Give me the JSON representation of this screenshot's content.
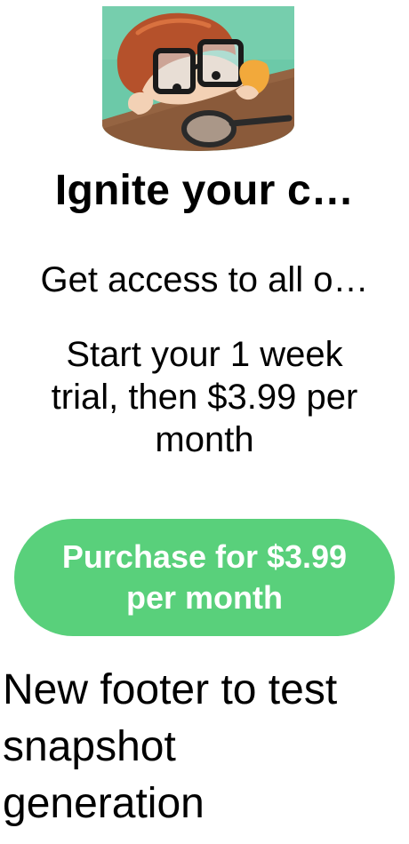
{
  "hero": {
    "icon": "child-with-glasses-and-magnifying-glass-illustration"
  },
  "title": "Ignite your c…",
  "subtitle": "Get access to all o…",
  "trial": {
    "lines": [
      "Start your 1 week",
      "trial, then $3.99 per",
      "month"
    ]
  },
  "purchase_button": {
    "lines": [
      "Purchase for $3.99",
      "per month"
    ],
    "color": "#59d07b"
  },
  "footer": {
    "lines": [
      "New footer to test",
      "snapshot",
      "generation"
    ]
  }
}
